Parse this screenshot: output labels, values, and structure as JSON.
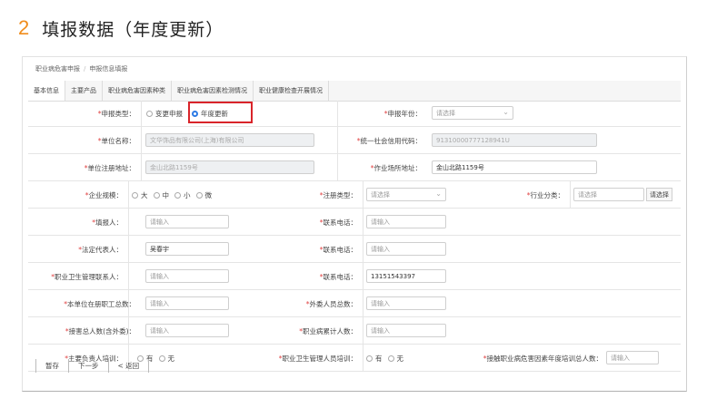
{
  "slide": {
    "number": "2",
    "title": "填报数据（年度更新）"
  },
  "breadcrumb": {
    "root": "职业病危害申报",
    "current": "申报信息填报"
  },
  "tabs": [
    "基本信息",
    "主要产品",
    "职业病危害因素种类",
    "职业病危害因素检测情况",
    "职业健康检查开展情况"
  ],
  "form": {
    "declare_type": {
      "label": "申报类型：",
      "options": [
        "变更申报",
        "年度更新"
      ],
      "selected": "年度更新"
    },
    "declare_year": {
      "label": "申报年份：",
      "placeholder": "请选择"
    },
    "company_name": {
      "label": "单位名称：",
      "value": "文华饰品有限公司(上海)有限公司"
    },
    "credit_code": {
      "label": "统一社会信用代码：",
      "value": "91310000777128941U"
    },
    "registered_address": {
      "label": "单位注册地址：",
      "value": "金山北路1159号"
    },
    "work_address": {
      "label": "作业场所地址：",
      "value": "金山北路1159号"
    },
    "enterprise_scale": {
      "label": "企业规模：",
      "options": [
        "大",
        "中",
        "小",
        "微"
      ]
    },
    "registration_type": {
      "label": "注册类型：",
      "placeholder": "请选择"
    },
    "industry": {
      "label": "行业分类：",
      "placeholder": "请选择",
      "button": "请选择"
    },
    "filler": {
      "label": "填报人：",
      "placeholder": "请输入"
    },
    "contact_phone": {
      "label": "联系电话：",
      "placeholder": "请输入"
    },
    "legal_rep": {
      "label": "法定代表人：",
      "value": "吴春宇"
    },
    "legal_rep_phone": {
      "label": "联系电话：",
      "placeholder": "请输入"
    },
    "oh_manager": {
      "label": "职业卫生管理联系人：",
      "placeholder": "请输入"
    },
    "oh_manager_phone": {
      "label": "联系电话：",
      "value": "13151543397"
    },
    "staff_total": {
      "label": "本单位在册职工总数：",
      "placeholder": "请输入"
    },
    "outsourced_total": {
      "label": "外委人员总数：",
      "placeholder": "请输入"
    },
    "exposed_total": {
      "label": "接害总人数(含外委)：",
      "placeholder": "请输入"
    },
    "disease_total": {
      "label": "职业病累计人数：",
      "placeholder": "请输入"
    },
    "main_leader_trained": {
      "label": "主要负责人培训：",
      "options": [
        "有",
        "无"
      ]
    },
    "oh_admin_trained": {
      "label": "职业卫生管理人员培训：",
      "options": [
        "有",
        "无"
      ]
    },
    "exposed_trained": {
      "label": "接触职业病危害因素年度培训总人数：",
      "placeholder": "请输入"
    }
  },
  "buttons": {
    "save": "暂存",
    "next": "下一步",
    "back": "< 返回"
  },
  "colors": {
    "accent_number": "#f08c1c",
    "highlight_border": "#d9242a",
    "radio_selected": "#2c7be5"
  }
}
